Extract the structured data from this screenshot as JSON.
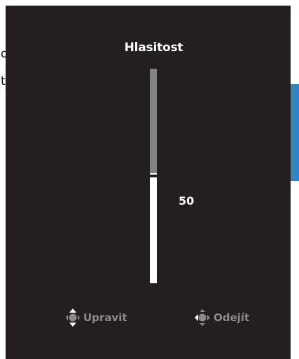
{
  "background": {
    "fragment_a": "o",
    "fragment_b": "ti"
  },
  "osd": {
    "title": "Hlasitost",
    "value": "50",
    "level_percent": 50,
    "hints": {
      "adjust": {
        "icon": "joystick-up-down-icon",
        "label": "Upravit"
      },
      "exit": {
        "icon": "joystick-left-icon",
        "label": "Odejít"
      }
    }
  },
  "colors": {
    "panel": "#231f20",
    "text": "#ffffff",
    "hint_text": "#8a8a8a",
    "track_empty": "#818181",
    "accent": "#2f84c6"
  }
}
